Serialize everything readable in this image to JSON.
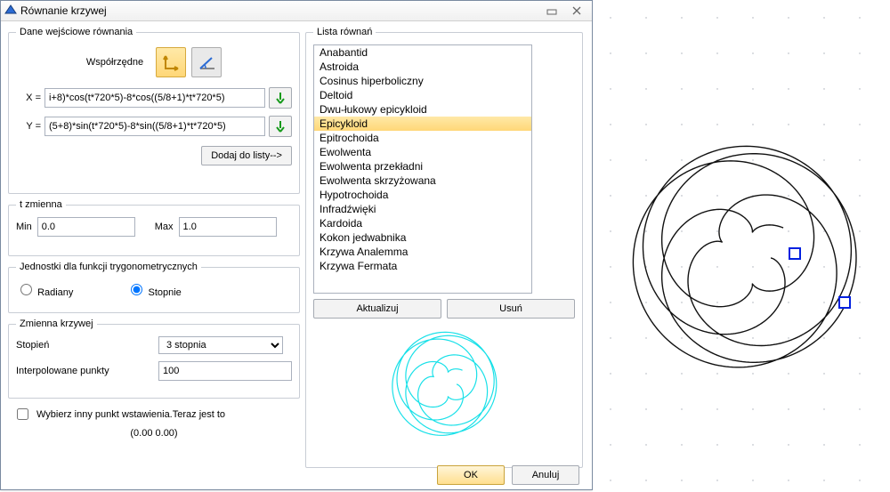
{
  "window": {
    "title": "Równanie krzywej"
  },
  "input_group": {
    "legend": "Dane wejściowe równania",
    "coord_label": "Współrzędne",
    "x_label": "X =",
    "y_label": "Y =",
    "x_value": "i+8)*cos(t*720*5)-8*cos((5/8+1)*t*720*5)",
    "y_value": "(5+8)*sin(t*720*5)-8*sin((5/8+1)*t*720*5)",
    "add_button": "Dodaj do listy-->"
  },
  "t_group": {
    "legend": "t zmienna",
    "min_label": "Min",
    "min_value": "0.0",
    "max_label": "Max",
    "max_value": "1.0"
  },
  "units_group": {
    "legend": "Jednostki dla funkcji trygonometrycznych",
    "radians": "Radiany",
    "degrees": "Stopnie",
    "selected": "degrees"
  },
  "var_group": {
    "legend": "Zmienna krzywej",
    "degree_label": "Stopień",
    "degree_value": "3 stopnia",
    "points_label": "Interpolowane punkty",
    "points_value": "100"
  },
  "insert": {
    "checkbox_label": "Wybierz inny punkt wstawienia.Teraz jest to",
    "point": "(0.00 0.00)"
  },
  "list_group": {
    "legend": "Lista równań",
    "items": [
      "Anabantid",
      "Astroida",
      "Cosinus hiperboliczny",
      "Deltoid",
      "Dwu-łukowy epicykloid",
      "Epicykloid",
      "Epitrochoida",
      "Ewolwenta",
      "Ewolwenta przekładni",
      "Ewolwenta skrzyżowana",
      "Hypotrochoida",
      "Infradźwięki",
      "Kardoida",
      "Kokon jedwabnika",
      "Krzywa Analemma",
      "Krzywa Fermata"
    ],
    "selected_index": 5,
    "update_button": "Aktualizuj",
    "delete_button": "Usuń"
  },
  "dialog_buttons": {
    "ok": "OK",
    "cancel": "Anuluj"
  }
}
